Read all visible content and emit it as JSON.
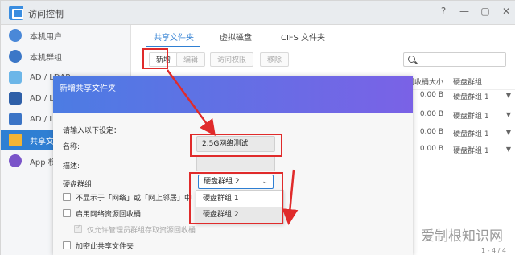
{
  "window": {
    "title": "访问控制",
    "controls": [
      "?",
      "—",
      "▢",
      "✕"
    ]
  },
  "sidebar": {
    "items": [
      {
        "label": "本机用户",
        "icon": "user-icon"
      },
      {
        "label": "本机群组",
        "icon": "group-icon"
      },
      {
        "label": "AD / LDAP",
        "icon": "ldap-key-icon"
      },
      {
        "label": "AD / LDA",
        "icon": "ldap-user-icon"
      },
      {
        "label": "AD / LDA",
        "icon": "ldap-group-icon"
      },
      {
        "label": "共享文件",
        "icon": "shared-folder-icon",
        "active": true
      },
      {
        "label": "App 权限",
        "icon": "app-permission-icon"
      }
    ]
  },
  "tabs": [
    {
      "label": "共享文件夹",
      "active": true
    },
    {
      "label": "虚拟磁盘"
    },
    {
      "label": "CIFS 文件夹"
    }
  ],
  "toolbar": {
    "new": "新增",
    "edit": "编辑",
    "access": "访问权限",
    "remove": "移除"
  },
  "table": {
    "headers": {
      "size": "回收桶大小",
      "group": "硬盘群组"
    },
    "rows": [
      {
        "size": "0.00 B",
        "group": "硬盘群组 1"
      },
      {
        "size": "0.00 B",
        "group": "硬盘群组 1"
      },
      {
        "size": "0.00 B",
        "group": "硬盘群组 1"
      },
      {
        "size": "0.00 B",
        "group": "硬盘群组 1"
      }
    ],
    "pager": "1 - 4 / 4"
  },
  "dialog": {
    "title": "新增共享文件夹",
    "prompt": "请输入以下设定：",
    "name_label": "名称:",
    "name_value": "2.5G网络测试",
    "desc_label": "描述:",
    "desc_value": "",
    "volume_label": "硬盘群组:",
    "volume_value": "硬盘群组 2",
    "volume_options": [
      "硬盘群组 1",
      "硬盘群组 2"
    ],
    "checkboxes": [
      {
        "label": "不显示于「网络」或「网上邻居」中",
        "checked": false
      },
      {
        "label": "启用网络资源回收桶",
        "checked": false
      },
      {
        "label": "仅允许管理员群组存取资源回收桶",
        "checked": true,
        "disabled": true
      },
      {
        "label": "加密此共享文件夹",
        "checked": false
      }
    ]
  },
  "annotations": {
    "color": "#e02b2b"
  },
  "watermark": "爱制根知识网"
}
